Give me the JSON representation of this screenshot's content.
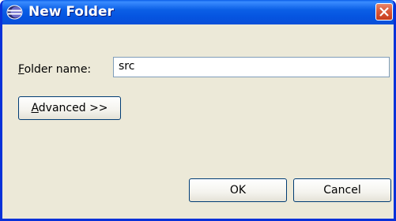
{
  "window": {
    "title": "New Folder",
    "title_icon": "eclipse-icon",
    "close_icon": "close-icon",
    "titlebar_color": "#0554e0",
    "body_color": "#ece9d8",
    "close_color": "#d9593a"
  },
  "form": {
    "folder_name_label_mnemonic": "F",
    "folder_name_label_rest": "older name:",
    "folder_name_value": "src"
  },
  "buttons": {
    "advanced_mnemonic": "A",
    "advanced_rest": "dvanced >>",
    "ok": "OK",
    "cancel": "Cancel"
  }
}
